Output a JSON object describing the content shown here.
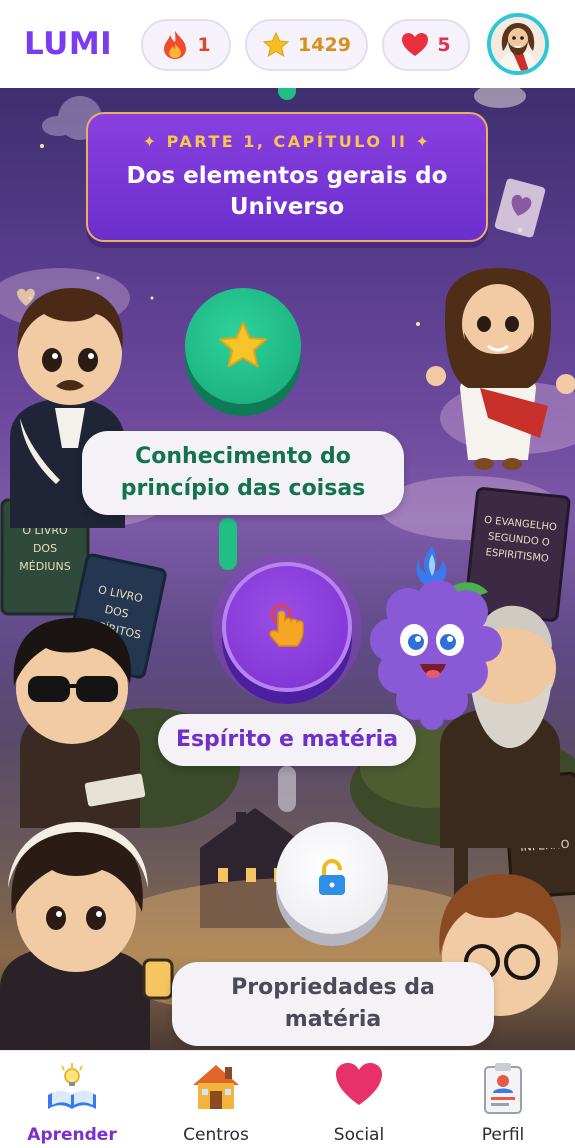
{
  "header": {
    "brand": "LUMI",
    "streak": {
      "value": "1",
      "icon": "flame-icon",
      "color": "#e0442a"
    },
    "stars": {
      "value": "1429",
      "icon": "star-icon",
      "color": "#f2b81e"
    },
    "lives": {
      "value": "5",
      "icon": "heart-icon",
      "color": "#e0304a"
    },
    "avatar": {
      "icon": "jesus-avatar"
    }
  },
  "path": {
    "chapter_kicker": "✦ PARTE 1, CAPÍTULO II ✦",
    "chapter_title_line1": "Dos elementos gerais do",
    "chapter_title_line2": "Universo",
    "lessons": [
      {
        "line1": "Conhecimento do",
        "line2": "princípio das coisas",
        "state": "completed",
        "icon": "star-icon",
        "color": "#1fbf85"
      },
      {
        "label": "Espírito e matéria",
        "state": "current",
        "icon": "tap-hand-icon",
        "color": "#7a30d0"
      },
      {
        "line1": "Propriedades da",
        "line2": "matéria",
        "state": "locked",
        "icon": "lock-icon",
        "color": "#ffffff"
      }
    ],
    "books": [
      "O LIVRO DOS MÉDIUNS",
      "O LIVRO DOS ESPÍRITOS",
      "O EVANGELHO SEGUNDO O ESPIRITISMO",
      "O CÉU E O INFERNO"
    ]
  },
  "nav": {
    "items": [
      {
        "label": "Aprender",
        "icon": "book-lightbulb-icon",
        "active": true
      },
      {
        "label": "Centros",
        "icon": "house-icon",
        "active": false
      },
      {
        "label": "Social",
        "icon": "heart-icon",
        "active": false
      },
      {
        "label": "Perfil",
        "icon": "id-card-icon",
        "active": false
      }
    ],
    "active_color": "#7a2fd0"
  }
}
